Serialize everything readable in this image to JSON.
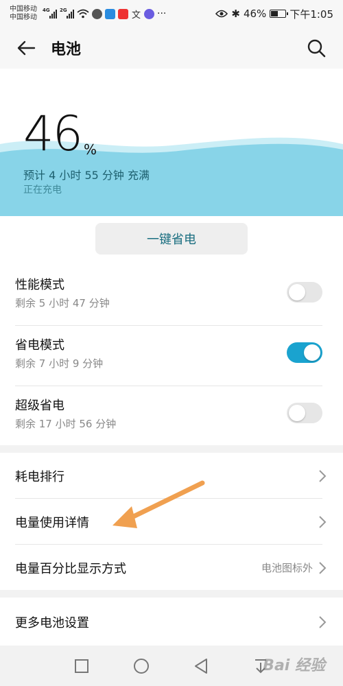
{
  "status_bar": {
    "carrier1": "中国移动",
    "carrier2": "中国移动",
    "sig1_tag": "4G",
    "sig2_tag": "2G",
    "ellipsis": "···",
    "battery_pct": "46%",
    "time": "下午1:05",
    "bluetooth": "✱",
    "app_icon_3": "文",
    "bluetooth_icon": "bluetooth-icon"
  },
  "header": {
    "title": "电池"
  },
  "battery": {
    "level_value": 46,
    "level": "46",
    "unit": "%",
    "estimate": "预计 4 小时 55 分钟 充满",
    "charging": "正在充电"
  },
  "one_key_save": {
    "label": "一键省电"
  },
  "modes": [
    {
      "title": "性能模式",
      "remaining": "剩余 5 小时 47 分钟",
      "enabled": false
    },
    {
      "title": "省电模式",
      "remaining": "剩余 7 小时 9 分钟",
      "enabled": true
    },
    {
      "title": "超级省电",
      "remaining": "剩余 17 小时 56 分钟",
      "enabled": false
    }
  ],
  "settings": [
    {
      "label": "耗电排行"
    },
    {
      "label": "电量使用详情"
    },
    {
      "label": "电量百分比显示方式",
      "value": "电池图标外"
    }
  ],
  "more": {
    "label": "更多电池设置"
  },
  "watermark": "Bai 经验",
  "colors": {
    "accent": "#1aa3cf",
    "wave": "#7fd1e6",
    "annotation_arrow": "#f0a050"
  }
}
